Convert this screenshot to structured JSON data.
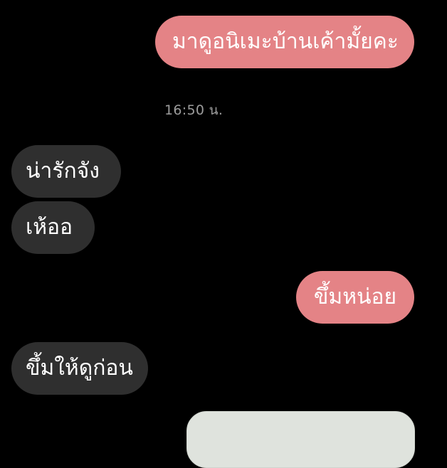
{
  "messages": [
    {
      "direction": "sent",
      "text": "มาดูอนิเมะบ้านเค้ามั้ยคะ"
    },
    {
      "direction": "received",
      "text": "น่ารักจัง"
    },
    {
      "direction": "received",
      "text": "เห้ออ"
    },
    {
      "direction": "sent",
      "text": "ขึ้มหน่อย"
    },
    {
      "direction": "received",
      "text": "ขึ้มให้ดูก่อน"
    }
  ],
  "timestamp": "16:50 น.",
  "colors": {
    "background": "#000000",
    "sent_bubble": "#e48386",
    "received_bubble": "#2f2f2f",
    "timestamp_text": "#9c9c9c",
    "image_placeholder": "#dfe3dd"
  }
}
